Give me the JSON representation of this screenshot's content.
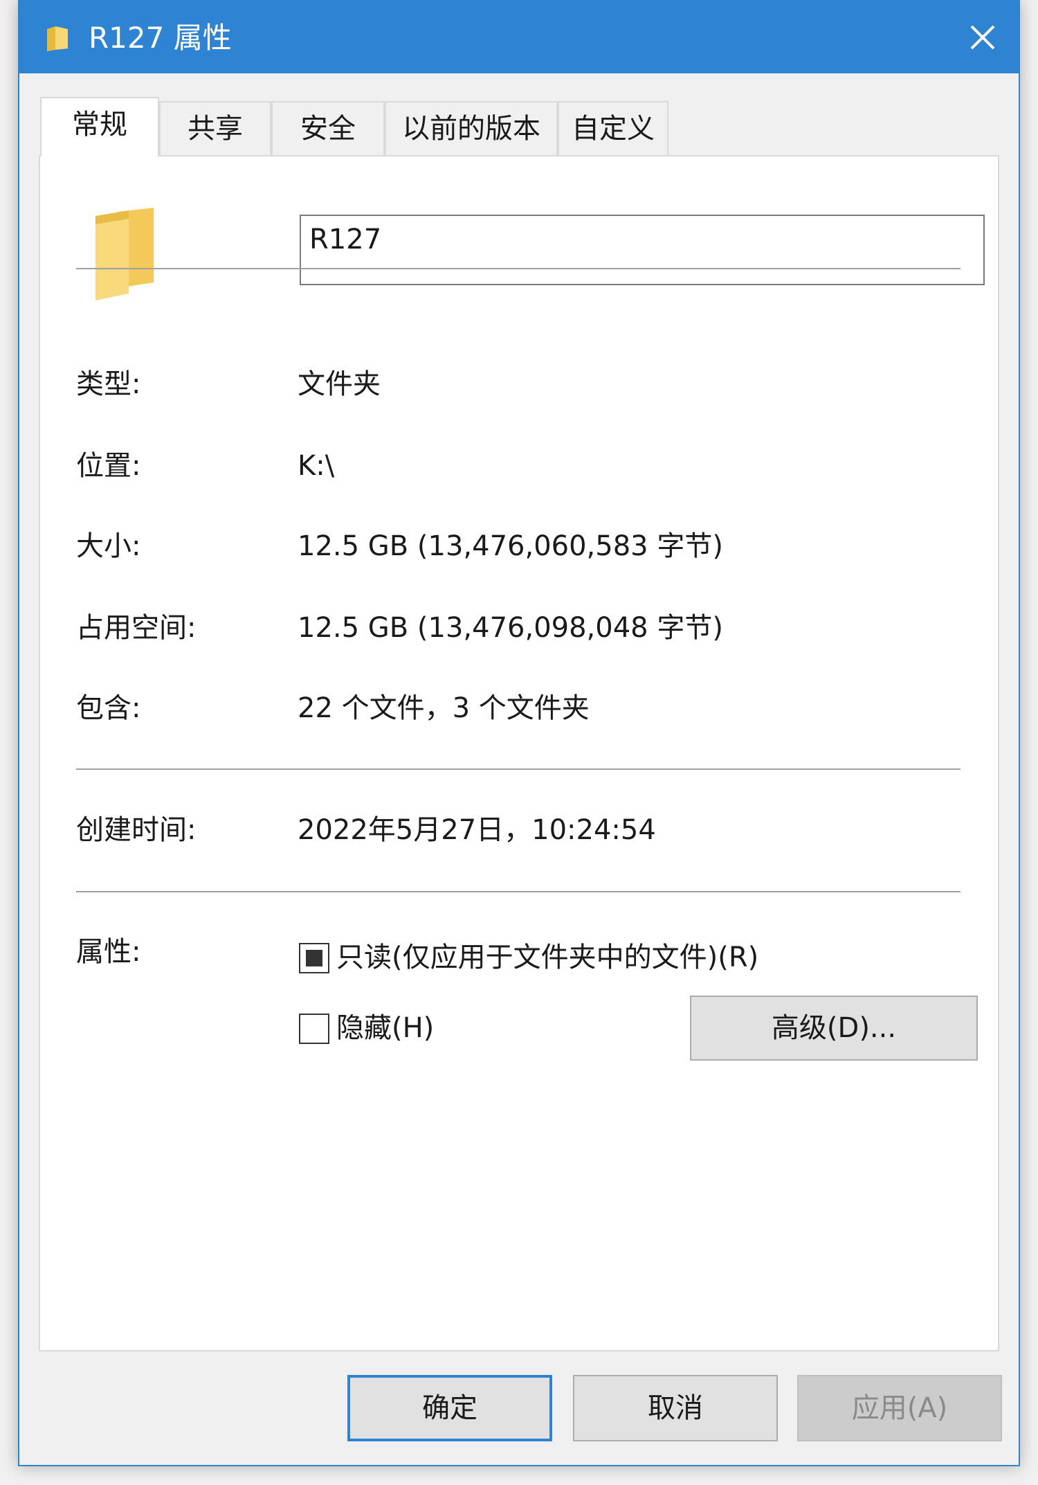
{
  "window": {
    "title": "R127 属性",
    "title_icon": "folder-icon",
    "close_icon": "close-icon",
    "accent_color": "#2f83d3"
  },
  "tabs": [
    {
      "label": "常规",
      "active": true
    },
    {
      "label": "共享",
      "active": false
    },
    {
      "label": "安全",
      "active": false
    },
    {
      "label": "以前的版本",
      "active": false
    },
    {
      "label": "自定义",
      "active": false
    }
  ],
  "general": {
    "icon": "folder-icon",
    "name_value": "R127",
    "type": {
      "label": "类型:",
      "value": "文件夹"
    },
    "location": {
      "label": "位置:",
      "value": "K:\\"
    },
    "size": {
      "label": "大小:",
      "value": "12.5 GB (13,476,060,583 字节)"
    },
    "size_on_disk": {
      "label": "占用空间:",
      "value": "12.5 GB (13,476,098,048 字节)"
    },
    "contains": {
      "label": "包含:",
      "value": "22 个文件，3 个文件夹"
    },
    "created": {
      "label": "创建时间:",
      "value": "2022年5月27日，10:24:54"
    },
    "attributes": {
      "label": "属性:",
      "readonly": {
        "label": "只读(仅应用于文件夹中的文件)(R)",
        "state": "indeterminate"
      },
      "hidden": {
        "label": "隐藏(H)",
        "state": "unchecked"
      },
      "advanced_button": "高级(D)..."
    }
  },
  "footer": {
    "ok": "确定",
    "cancel": "取消",
    "apply": "应用(A)"
  }
}
